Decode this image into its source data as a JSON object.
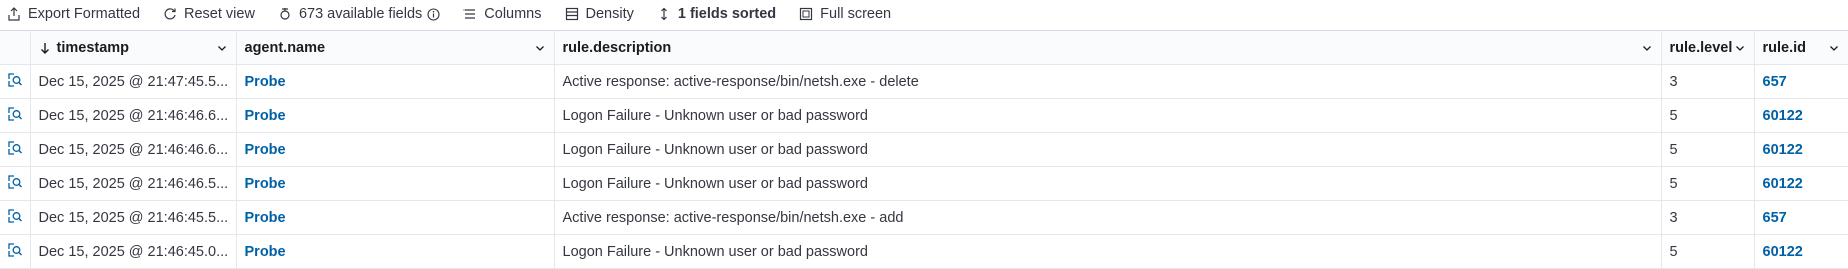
{
  "toolbar": {
    "export_label": "Export Formatted",
    "reset_label": "Reset view",
    "fields_label": "673 available fields",
    "columns_label": "Columns",
    "density_label": "Density",
    "sorted_label": "1 fields sorted",
    "fullscreen_label": "Full screen"
  },
  "columns": {
    "timestamp": "timestamp",
    "agent": "agent.name",
    "description": "rule.description",
    "level": "rule.level",
    "id": "rule.id"
  },
  "rows": [
    {
      "timestamp": "Dec 15, 2025 @ 21:47:45.5...",
      "agent": "Probe",
      "description": "Active response: active-response/bin/netsh.exe - delete",
      "level": "3",
      "id": "657"
    },
    {
      "timestamp": "Dec 15, 2025 @ 21:46:46.6...",
      "agent": "Probe",
      "description": "Logon Failure - Unknown user or bad password",
      "level": "5",
      "id": "60122"
    },
    {
      "timestamp": "Dec 15, 2025 @ 21:46:46.6...",
      "agent": "Probe",
      "description": "Logon Failure - Unknown user or bad password",
      "level": "5",
      "id": "60122"
    },
    {
      "timestamp": "Dec 15, 2025 @ 21:46:46.5...",
      "agent": "Probe",
      "description": "Logon Failure - Unknown user or bad password",
      "level": "5",
      "id": "60122"
    },
    {
      "timestamp": "Dec 15, 2025 @ 21:46:45.5...",
      "agent": "Probe",
      "description": "Active response: active-response/bin/netsh.exe - add",
      "level": "3",
      "id": "657"
    },
    {
      "timestamp": "Dec 15, 2025 @ 21:46:45.0...",
      "agent": "Probe",
      "description": "Logon Failure - Unknown user or bad password",
      "level": "5",
      "id": "60122"
    }
  ],
  "colors": {
    "link": "#0061a6",
    "border": "#e4e7ec",
    "text": "#343741"
  },
  "icons": [
    "export-icon",
    "reset-icon",
    "fields-icon",
    "info-icon",
    "columns-icon",
    "density-icon",
    "sort-icon",
    "fullscreen-icon",
    "expand-icon",
    "chevron-down-icon",
    "sort-desc-icon"
  ]
}
